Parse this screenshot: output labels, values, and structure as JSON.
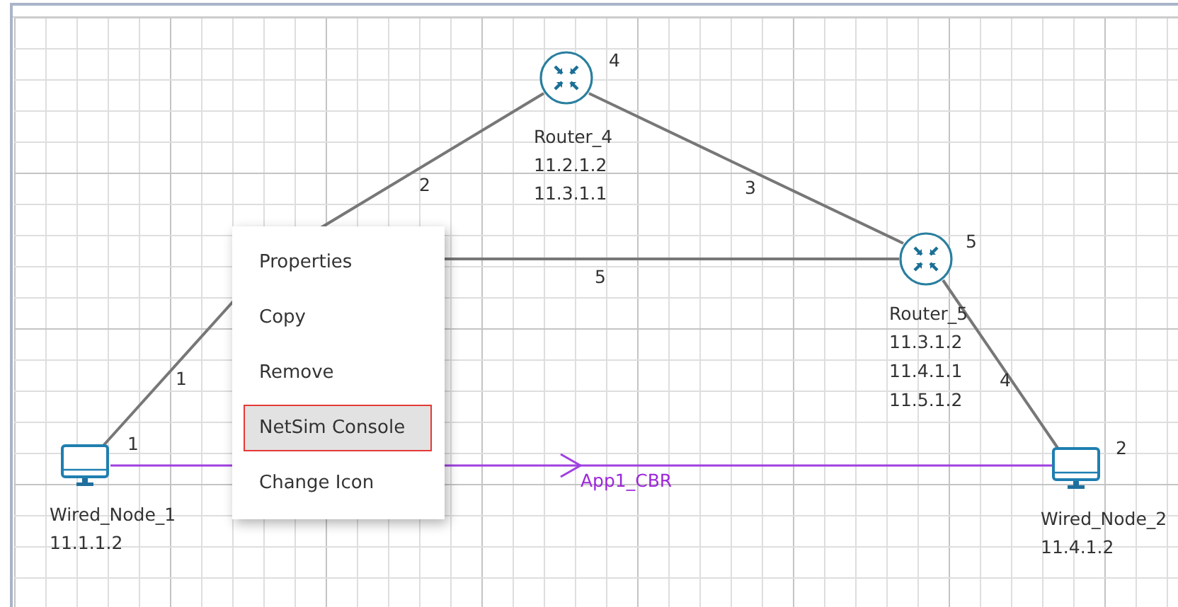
{
  "nodes": [
    {
      "kind": "router",
      "name": "Router_4",
      "device_id": "4",
      "addresses": [
        "11.2.1.2",
        "11.3.1.1"
      ]
    },
    {
      "kind": "router",
      "name": "Router_5",
      "device_id": "5",
      "addresses": [
        "11.3.1.2",
        "11.4.1.1",
        "11.5.1.2"
      ]
    },
    {
      "kind": "wired_node",
      "name": "Wired_Node_1",
      "device_id": "1",
      "addresses": [
        "11.1.1.2"
      ]
    },
    {
      "kind": "wired_node",
      "name": "Wired_Node_2",
      "device_id": "2",
      "addresses": [
        "11.4.1.2"
      ]
    }
  ],
  "links": [
    {
      "label": "1"
    },
    {
      "label": "2"
    },
    {
      "label": "3"
    },
    {
      "label": "5"
    },
    {
      "label": "4"
    }
  ],
  "application": {
    "name": "App1_CBR"
  },
  "context_menu": {
    "items": [
      {
        "label": "Properties",
        "selected": false
      },
      {
        "label": "Copy",
        "selected": false
      },
      {
        "label": "Remove",
        "selected": false
      },
      {
        "label": "NetSim Console",
        "selected": true
      },
      {
        "label": "Change Icon",
        "selected": false
      }
    ]
  }
}
